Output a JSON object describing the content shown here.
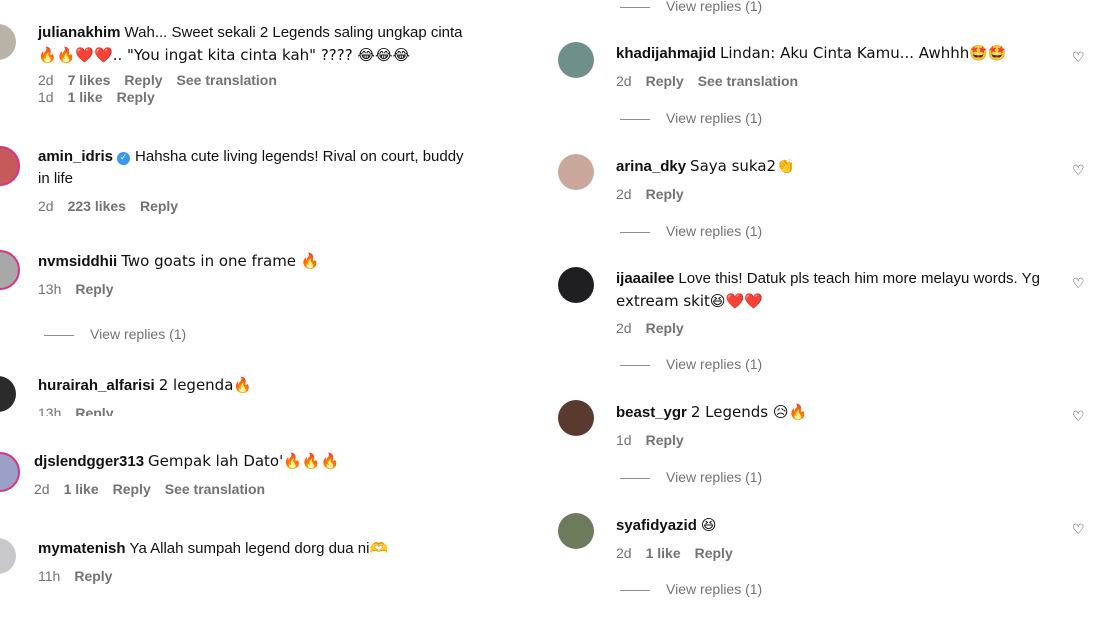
{
  "actions": {
    "reply": "Reply",
    "see_translation": "See translation"
  },
  "left": [
    {
      "username": "julianakhim",
      "text": "Wah... Sweet sekali 2 Legends saling ungkap cinta",
      "text2": "🔥🔥❤️❤️.. \"You ingat kita cinta kah\" ???? 😂😂😂",
      "time": "2d",
      "likes": "7 likes",
      "sub_time": "1d",
      "sub_likes": "1 like"
    },
    {
      "username": "amin_idris",
      "verified": "✓",
      "text": "Hahsha cute living legends! Rival on court, buddy",
      "text2": "in life",
      "time": "2d",
      "likes": "223 likes"
    },
    {
      "username": "nvmsiddhii",
      "text": "Two goats in one frame 🔥",
      "time": "13h",
      "view_replies": "View replies (1)"
    },
    {
      "username": "hurairah_alfarisi",
      "text": "2 legenda🔥",
      "time": "13h"
    },
    {
      "username": "djslendgger313",
      "text": "Gempak lah Dato'🔥🔥🔥",
      "time": "2d",
      "likes": "1 like"
    },
    {
      "username": "mymatenish",
      "text": "Ya Allah sumpah legend dorg dua ni🫶",
      "time": "11h"
    }
  ],
  "right": {
    "top_view_replies": "View replies (1)",
    "comments": [
      {
        "username": "khadijahmajid",
        "text": "Lindan: Aku Cinta Kamu... Awhhh🤩🤩",
        "time": "2d",
        "view_replies": "View replies (1)"
      },
      {
        "username": "arina_dky",
        "text": "Saya suka2👏",
        "time": "2d",
        "view_replies": "View replies (1)"
      },
      {
        "username": "ijaaailee",
        "text": "Love this! Datuk pls teach him more melayu words. Yg",
        "text2": "extream skit😆❤️❤️",
        "time": "2d",
        "view_replies": "View replies (1)"
      },
      {
        "username": "beast_ygr",
        "text": "2 Legends 😥🔥",
        "time": "1d",
        "view_replies": "View replies (1)"
      },
      {
        "username": "syafidyazid",
        "text": "😆",
        "time": "2d",
        "likes": "1 like",
        "view_replies": "View replies (1)"
      }
    ]
  },
  "icons": {
    "heart": "heart-outline-icon"
  }
}
